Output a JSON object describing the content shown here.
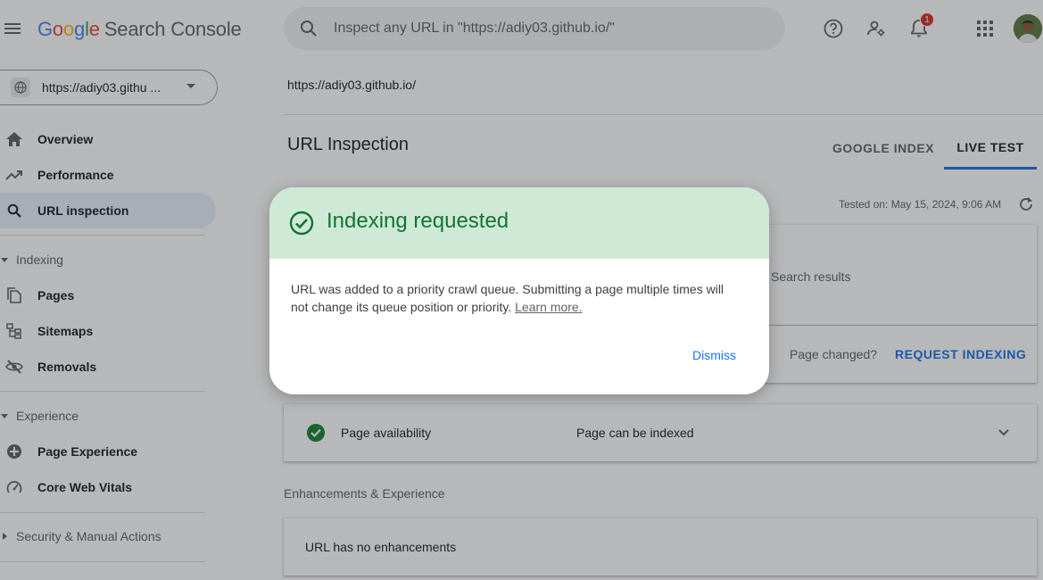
{
  "app": {
    "logo_letters": [
      "G",
      "o",
      "o",
      "g",
      "l",
      "e"
    ],
    "product": "Search Console",
    "search_placeholder": "Inspect any URL in \"https://adiy03.github.io/\"",
    "notification_count": "1"
  },
  "sidebar": {
    "property": "https://adiy03.githu ...",
    "top_items": [
      {
        "label": "Overview",
        "icon": "home-icon"
      },
      {
        "label": "Performance",
        "icon": "trending-up-icon"
      },
      {
        "label": "URL inspection",
        "icon": "search-icon",
        "active": true
      }
    ],
    "sections": [
      {
        "label": "Indexing",
        "items": [
          {
            "label": "Pages",
            "icon": "pages-icon"
          },
          {
            "label": "Sitemaps",
            "icon": "sitemap-icon"
          },
          {
            "label": "Removals",
            "icon": "removals-icon"
          }
        ]
      },
      {
        "label": "Experience",
        "items": [
          {
            "label": "Page Experience",
            "icon": "page-experience-icon"
          },
          {
            "label": "Core Web Vitals",
            "icon": "speedometer-icon"
          }
        ]
      },
      {
        "label": "Security & Manual Actions",
        "collapsed": true
      }
    ]
  },
  "main": {
    "url": "https://adiy03.github.io/",
    "title": "URL Inspection",
    "tabs": [
      {
        "label": "GOOGLE INDEX",
        "active": false
      },
      {
        "label": "LIVE TEST",
        "active": true
      }
    ],
    "tested_on": "Tested on: May 15, 2024, 9:06 AM",
    "result_card_text": "Search results",
    "page_changed": "Page changed?",
    "request_indexing": "REQUEST INDEXING",
    "availability": {
      "label": "Page availability",
      "value": "Page can be indexed"
    },
    "enhancements_heading": "Enhancements & Experience",
    "enhancements_text": "URL has no enhancements"
  },
  "dialog": {
    "title": "Indexing requested",
    "body": "URL was added to a priority crawl queue. Submitting a page multiple times will not change its queue position or priority.",
    "link": "Learn more.",
    "dismiss": "Dismiss"
  },
  "colors": {
    "accent": "#1a73e8",
    "success": "#137333",
    "success_bg": "#ceead6",
    "active_nav_bg": "#e8f0fe"
  }
}
